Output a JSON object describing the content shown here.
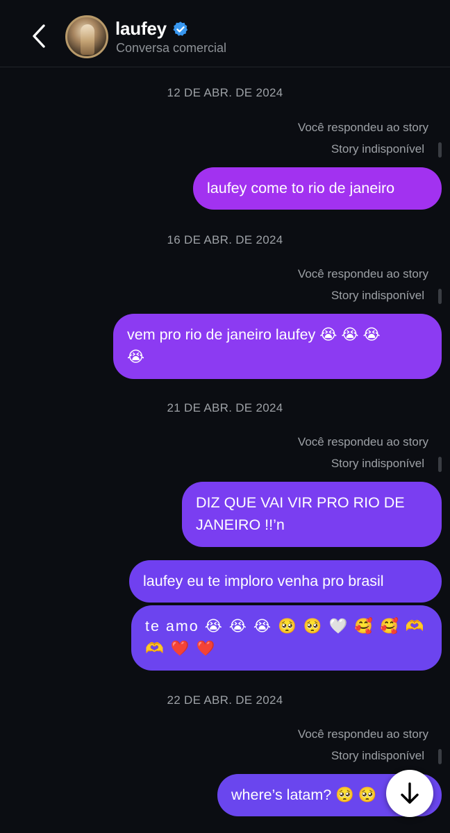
{
  "header": {
    "name": "laufey",
    "subtitle": "Conversa comercial",
    "verified_color": "#3897f0"
  },
  "reply_note": "Você respondeu ao story",
  "story_unavailable": "Story indisponível",
  "colors": {
    "background": "#0b0d12",
    "bubble_purple_1": "#a232f0",
    "bubble_purple_2": "#8c3bf2",
    "bubble_purple_3": "#7040f0",
    "bubble_purple_4": "#6a46ee",
    "muted_text": "#9da1a6"
  },
  "conversation": [
    {
      "date": "12 DE ABR. DE 2024",
      "messages": [
        {
          "text": "laufey come to rio de janeiro"
        }
      ]
    },
    {
      "date": "16 DE ABR. DE 2024",
      "messages": [
        {
          "line1": "vem pro rio de janeiro laufey 😭 😭 😭",
          "line2": "😭"
        }
      ]
    },
    {
      "date": "21 DE ABR. DE 2024",
      "messages": [
        {
          "line1": "DIZ QUE VAI VIR PRO RIO DE",
          "line2": "JANEIRO !!’n"
        },
        {
          "text": "laufey eu te imploro venha pro brasil"
        },
        {
          "line1": "te amo 😭 😭 😭 🥺 🥺 🤍 🥰 🥰 🫶",
          "line2": "🫶 ❤️ ❤️"
        }
      ]
    },
    {
      "date": "22 DE ABR. DE 2024",
      "messages": [
        {
          "text": "where’s latam? 🥺 🥺"
        }
      ]
    }
  ],
  "scroll_button_icon": "arrow-down-icon"
}
